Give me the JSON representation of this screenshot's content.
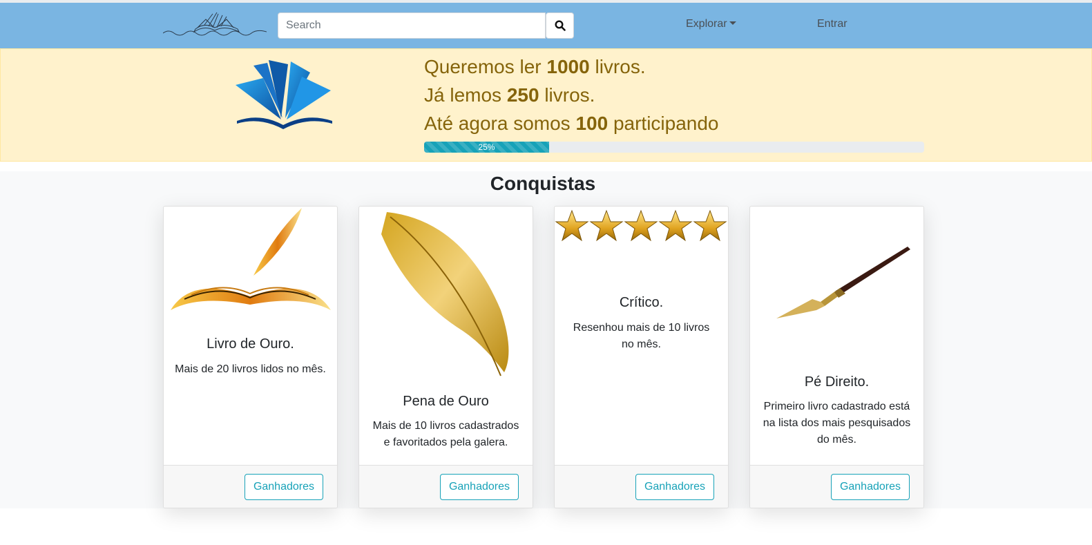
{
  "navbar": {
    "search": {
      "placeholder": "Search",
      "value": ""
    },
    "explorar_label": "Explorar",
    "entrar_label": "Entrar"
  },
  "hero": {
    "line1": {
      "before": "Queremos ler ",
      "number": "1000",
      "after": " livros."
    },
    "line2": {
      "before": "Já lemos ",
      "number": "250",
      "after": " livros."
    },
    "line3": {
      "before": "Até agora somos ",
      "number": "100",
      "after": " participando"
    },
    "progress": {
      "label": "25%",
      "fraction": 0.25
    }
  },
  "achievements": {
    "title": "Conquistas",
    "cards": [
      {
        "title": "Livro de Ouro.",
        "text": "Mais de 20 livros lidos no mês.",
        "button": "Ganhadores"
      },
      {
        "title": "Pena de Ouro",
        "text": "Mais de 10 livros cadastrados e favoritados pela galera.",
        "button": "Ganhadores"
      },
      {
        "title": "Crítico.",
        "text": "Resenhou mais de 10 livros no mês.",
        "button": "Ganhadores"
      },
      {
        "title": "Pé Direito.",
        "text": "Primeiro livro cadastrado está na lista dos mais pesquisados do mês.",
        "button": "Ganhadores"
      }
    ]
  },
  "colors": {
    "navbar_bg": "#7ab5e2",
    "hero_bg": "#fff2cc",
    "hero_text": "#85640b",
    "accent": "#17a2b8"
  }
}
